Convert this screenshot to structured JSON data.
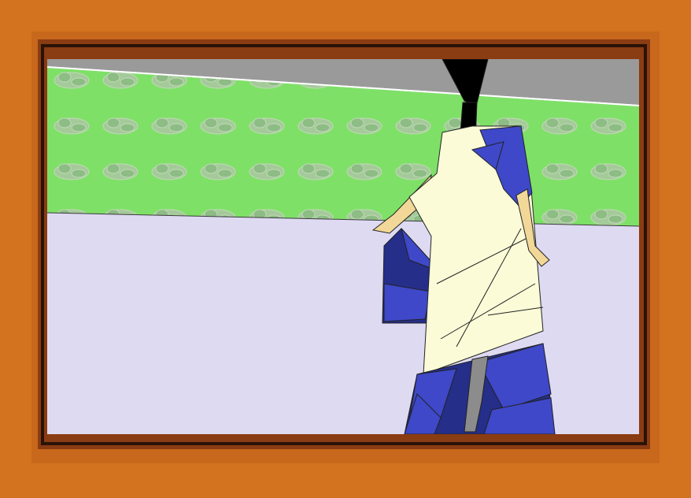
{
  "colors": {
    "frame_outer": "#d3721f",
    "frame_mid": "#c8681c",
    "frame_inner": "#8a3c12",
    "frame_dark": "#2a1208",
    "ceiling": "#9a9a9a",
    "wall": "#7fe068",
    "wall_pattern": "#a9c8a0",
    "floor": "#dedaf2",
    "robe_cream": "#fbfbd8",
    "robe_blue": "#3e48c8",
    "robe_navy": "#252e88",
    "skin": "#f2d898",
    "hair": "#000000",
    "grey": "#8c8c8c"
  },
  "scene": {
    "subject": "figure-in-kimono",
    "background": "patterned-wall-room"
  }
}
